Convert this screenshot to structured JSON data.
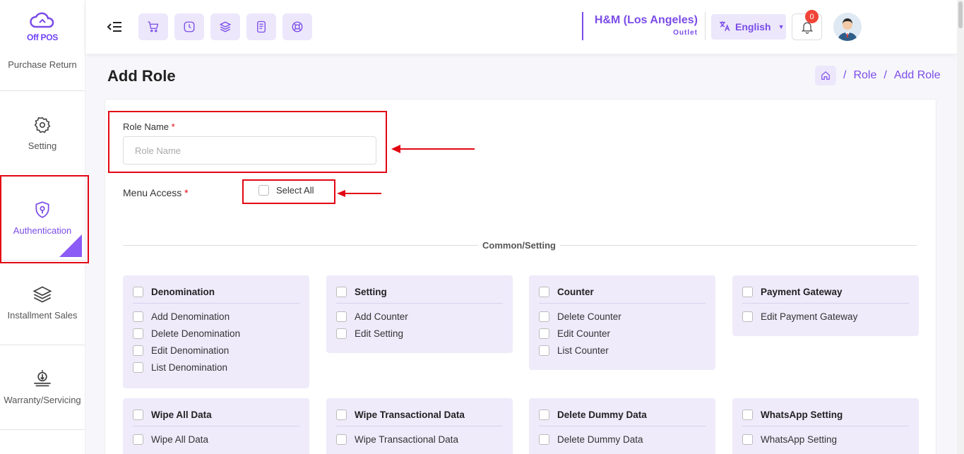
{
  "brand": {
    "logo_text": "Off POS",
    "accent": "#7b4ce8"
  },
  "sidebar": {
    "items": [
      {
        "label": "Purchase Return",
        "icon": "none"
      },
      {
        "label": "Setting",
        "icon": "gear-icon"
      },
      {
        "label": "Authentication",
        "icon": "shield-icon",
        "active": true
      },
      {
        "label": "Installment Sales",
        "icon": "layers-icon"
      },
      {
        "label": "Warranty/Servicing",
        "icon": "hand-coin-icon"
      }
    ]
  },
  "topbar": {
    "quick_buttons": [
      "cart-icon",
      "clock-icon",
      "layers-icon",
      "document-icon",
      "support-icon"
    ],
    "outlet_name": "H&M (Los Angeles)",
    "outlet_sub": "Outlet",
    "language": "English",
    "notifications": "0"
  },
  "page": {
    "title": "Add Role",
    "breadcrumb": [
      "Role",
      "Add Role"
    ]
  },
  "form": {
    "role_name_label": "Role Name",
    "role_name_placeholder": "Role Name",
    "role_name_value": "",
    "required_mark": "*",
    "menu_access_label": "Menu Access",
    "select_all_label": "Select All",
    "section_title": "Common/Setting"
  },
  "groups": [
    {
      "title": "Denomination",
      "perms": [
        "Add Denomination",
        "Delete Denomination",
        "Edit Denomination",
        "List Denomination"
      ]
    },
    {
      "title": "Setting",
      "perms": [
        "Add Counter",
        "Edit Setting"
      ]
    },
    {
      "title": "Counter",
      "perms": [
        "Delete Counter",
        "Edit Counter",
        "List Counter"
      ]
    },
    {
      "title": "Payment Gateway",
      "perms": [
        "Edit Payment Gateway"
      ]
    },
    {
      "title": "Wipe All Data",
      "perms": [
        "Wipe All Data"
      ]
    },
    {
      "title": "Wipe Transactional Data",
      "perms": [
        "Wipe Transactional Data"
      ]
    },
    {
      "title": "Delete Dummy Data",
      "perms": [
        "Delete Dummy Data"
      ]
    },
    {
      "title": "WhatsApp Setting",
      "perms": [
        "WhatsApp Setting"
      ]
    }
  ]
}
